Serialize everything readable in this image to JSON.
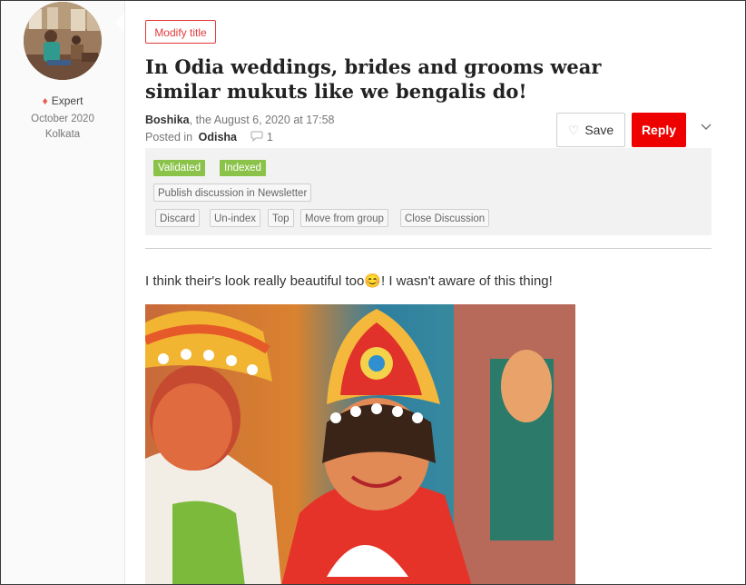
{
  "author_card": {
    "badge": "Expert",
    "joined": "October 2020",
    "location": "Kolkata"
  },
  "actions": {
    "modify_title": "Modify title",
    "save": "Save",
    "reply": "Reply"
  },
  "post": {
    "title": "In Odia weddings, brides and grooms wear similar mukuts like we bengalis do!",
    "author": "Boshika",
    "date_text": ", the August 6, 2020 at 17:58",
    "posted_in_prefix": "Posted in",
    "category": "Odisha",
    "comment_count": "1",
    "body_before": "I think their's look really beautiful too",
    "smiley": "😊",
    "body_after": "! I wasn't aware of this thing!"
  },
  "moderation": {
    "tags": [
      "Validated",
      "Indexed"
    ],
    "newsletter": "Publish discussion in Newsletter",
    "buttons": [
      "Discard",
      "Un-index",
      "Top",
      "Move from group",
      "Close Discussion"
    ]
  },
  "colors": {
    "accent_red": "#ee0000",
    "tag_green": "#8bc34a",
    "badge_gem": "#e8604c"
  },
  "icons": {
    "badge": "gem-icon",
    "save": "heart-icon",
    "comments": "speech-bubble-icon",
    "menu": "chevron-down-icon"
  }
}
